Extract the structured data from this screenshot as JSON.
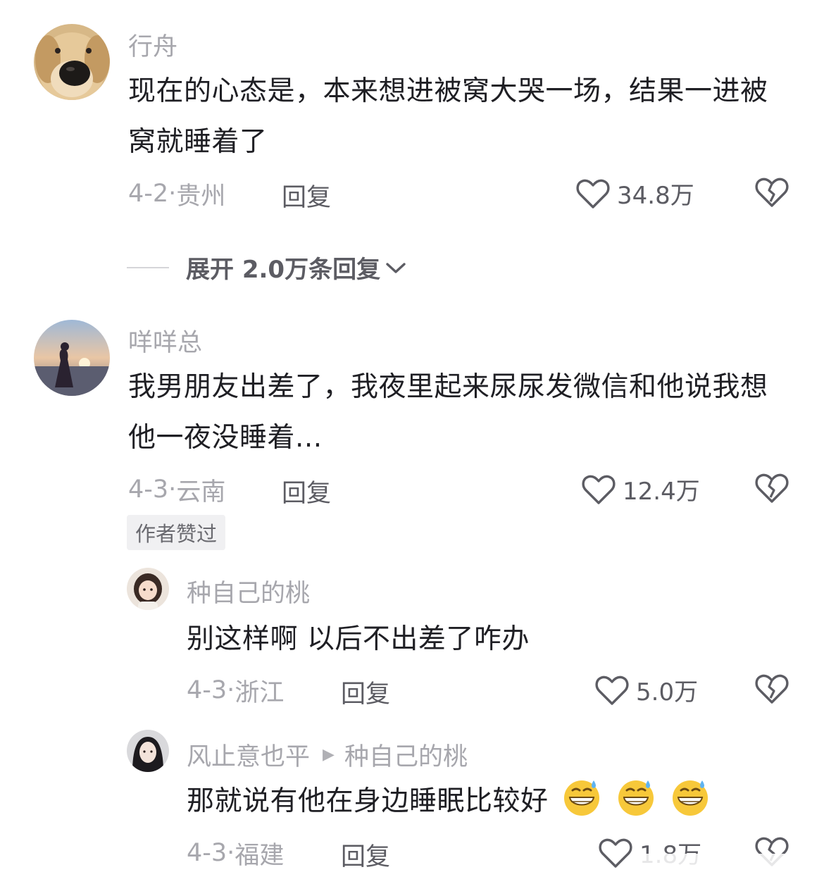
{
  "comments": [
    {
      "author": "行舟",
      "text": "现在的心态是，本来想进被窝大哭一场，结果一进被窝就睡着了",
      "date": "4-2",
      "location": "贵州",
      "reply_label": "回复",
      "likes": "34.8万"
    },
    {
      "author": "咩咩总",
      "text": "我男朋友出差了，我夜里起来尿尿发微信和他说我想他一夜没睡着...",
      "date": "4-3",
      "location": "云南",
      "reply_label": "回复",
      "likes": "12.4万",
      "badge": "作者赞过"
    }
  ],
  "expand_label": "展开 2.0万条回复",
  "replies": [
    {
      "author": "种自己的桃",
      "text": "别这样啊 以后不出差了咋办",
      "date": "4-3",
      "location": "浙江",
      "reply_label": "回复",
      "likes": "5.0万"
    },
    {
      "author": "风止意也平",
      "reply_to": "种自己的桃",
      "text": "那就说有他在身边睡眠比较好",
      "date": "4-3",
      "location": "福建",
      "reply_label": "回复",
      "likes": "1.8万"
    }
  ],
  "icons": {
    "like": "heart-outline-icon",
    "dislike": "broken-heart-icon",
    "expand": "chevron-down-icon",
    "emoji": "grinning-sweat-emoji"
  },
  "colors": {
    "text": "#1f1f24",
    "secondary": "#a7a7ad",
    "action": "#5c5c63",
    "badge_bg": "#f0f0f2"
  }
}
